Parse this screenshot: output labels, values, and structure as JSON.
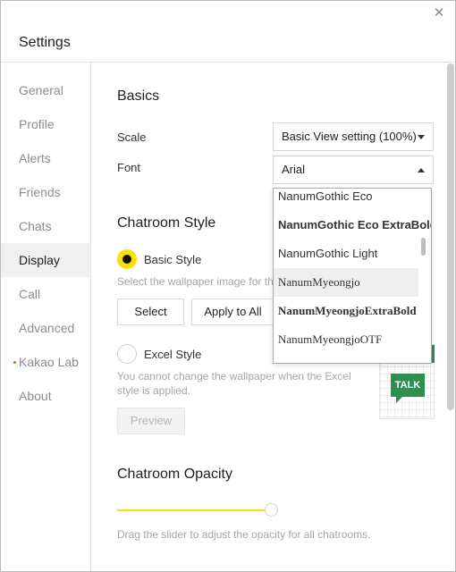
{
  "window": {
    "title": "Settings",
    "close_glyph": "✕"
  },
  "sidebar": {
    "items": [
      {
        "label": "General",
        "active": false
      },
      {
        "label": "Profile",
        "active": false
      },
      {
        "label": "Alerts",
        "active": false
      },
      {
        "label": "Friends",
        "active": false
      },
      {
        "label": "Chats",
        "active": false
      },
      {
        "label": "Display",
        "active": true
      },
      {
        "label": "Call",
        "active": false
      },
      {
        "label": "Advanced",
        "active": false
      },
      {
        "label": "Kakao Lab",
        "active": false,
        "new_dot": true
      },
      {
        "label": "About",
        "active": false
      }
    ]
  },
  "basics": {
    "heading": "Basics",
    "scale_label": "Scale",
    "scale_value": "Basic View setting (100%)",
    "font_label": "Font",
    "font_value": "Arial",
    "font_options": [
      "NanumGothic Eco",
      "NanumGothic Eco ExtraBold",
      "NanumGothic Light",
      "NanumMyeongjo",
      "NanumMyeongjoExtraBold",
      "NanumMyeongjoOTF"
    ],
    "hovered_option": "NanumMyeongjo"
  },
  "chatroom_style": {
    "heading": "Chatroom Style",
    "basic_label": "Basic Style",
    "basic_selected": true,
    "basic_desc": "Select the wallpaper image for th",
    "select_button": "Select",
    "apply_all_button": "Apply to All",
    "excel_label": "Excel Style",
    "excel_selected": false,
    "excel_desc": "You cannot change the wallpaper when the Excel style is applied.",
    "preview_button": "Preview",
    "preview_badge": "TALK"
  },
  "opacity": {
    "heading": "Chatroom Opacity",
    "desc": "Drag the slider to adjust the opacity for all chatrooms.",
    "level_percent": 100
  },
  "colors": {
    "accent_yellow": "#fae100",
    "talk_green": "#2f8f4e"
  }
}
